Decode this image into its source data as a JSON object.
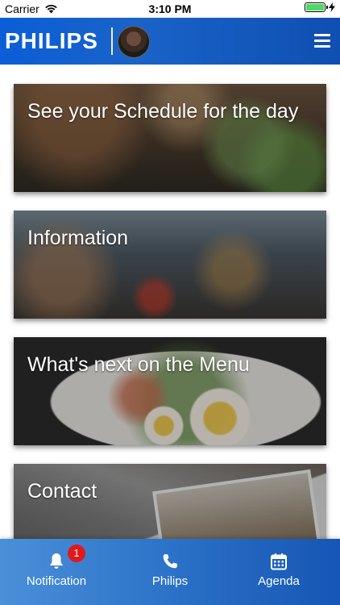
{
  "status_bar": {
    "carrier": "Carrier",
    "time": "3:10 PM"
  },
  "header": {
    "logo": "PHILIPS",
    "menu_icon": "hamburger-menu-icon"
  },
  "cards": [
    {
      "title": "See your Schedule for the day"
    },
    {
      "title": "Information"
    },
    {
      "title": "What's next on the Menu"
    },
    {
      "title": "Contact"
    }
  ],
  "tabbar": {
    "items": [
      {
        "label": "Notification",
        "icon": "bell-icon",
        "badge": "1"
      },
      {
        "label": "Philips",
        "icon": "phone-icon"
      },
      {
        "label": "Agenda",
        "icon": "calendar-icon"
      }
    ]
  },
  "colors": {
    "brand_blue": "#0b5ed7",
    "badge_red": "#e0191b",
    "battery_green": "#4cd964"
  }
}
